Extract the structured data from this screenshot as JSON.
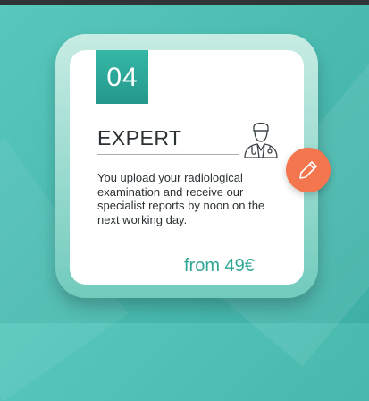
{
  "card": {
    "number": "04",
    "title": "EXPERT",
    "description": "You upload your radiological examination and receive our specialist reports by noon on the next working day.",
    "price": "from 49€",
    "icon": "doctor-icon"
  },
  "edit_button": {
    "icon": "pencil-icon"
  },
  "colors": {
    "background": "#4dbdb2",
    "frame": "#a7ddd2",
    "badge": "#23988b",
    "price": "#2fa794",
    "accent": "#f3764f",
    "text": "#2c3234"
  }
}
